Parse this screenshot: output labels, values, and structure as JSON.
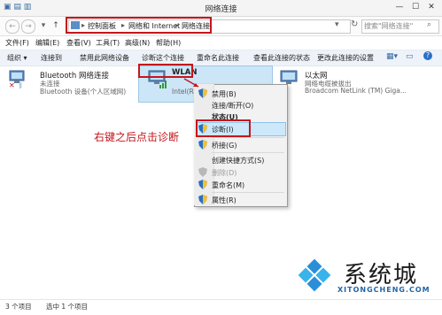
{
  "window": {
    "title": "网络连接",
    "minimize": "—",
    "maximize": "☐",
    "close": "✕"
  },
  "address": {
    "crumbs": [
      "控制面板",
      "网络和 Internet",
      "网络连接"
    ],
    "refresh": "↻",
    "search_placeholder": "搜索\"网络连接\""
  },
  "menu": [
    "文件(F)",
    "编辑(E)",
    "查看(V)",
    "工具(T)",
    "高级(N)",
    "帮助(H)"
  ],
  "toolbar": [
    "组织 ▾",
    "连接到",
    "禁用此网络设备",
    "诊断这个连接",
    "重命名此连接",
    "查看此连接的状态",
    "更改此连接的设置"
  ],
  "items": [
    {
      "name": "Bluetooth 网络连接",
      "status": "未连接",
      "device": "Bluetooth 设备(个人区域网)"
    },
    {
      "name": "WLAN",
      "status": "",
      "device": "Intel(R)"
    },
    {
      "name": "以太网",
      "status": "网络电缆被拔出",
      "device": "Broadcom NetLink (TM) Giga..."
    }
  ],
  "context_menu": [
    "禁用(B)",
    "连接/断开(O)",
    "状态(U)",
    "诊断(I)",
    "桥接(G)",
    "创建快捷方式(S)",
    "删除(D)",
    "重命名(M)",
    "属性(R)"
  ],
  "annotation": "右键之后点击诊断",
  "status_bar": {
    "count": "3 个项目",
    "selected": "选中 1 个项目"
  },
  "watermark": {
    "brand": "系统城",
    "url": "XITONGCHENG.COM"
  },
  "colors": {
    "highlight_box": "#c4161c",
    "command_bar": "#eef3fa",
    "selection": "#cde6f7"
  }
}
